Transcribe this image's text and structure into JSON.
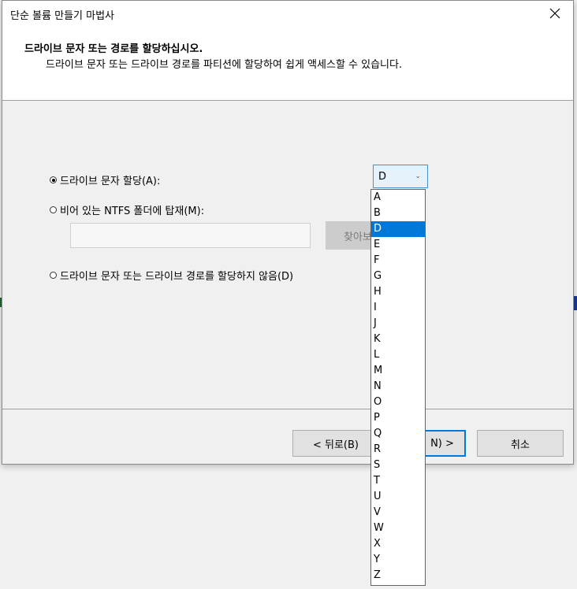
{
  "window": {
    "title": "단순 볼륨 만들기 마법사"
  },
  "header": {
    "title": "드라이브 문자 또는 경로를 할당하십시오.",
    "subtitle": "드라이브 문자 또는 드라이브 경로를 파티션에 할당하여 쉽게 액세스할 수 있습니다."
  },
  "options": {
    "assign_letter": "드라이브 문자 할당(A):",
    "mount_folder": "비어 있는 NTFS 폴더에 탑재(M):",
    "no_assign": "드라이브 문자 또는 드라이브 경로를 할당하지 않음(D)",
    "selected": "assign_letter"
  },
  "combo": {
    "value": "D"
  },
  "folder": {
    "path_value": "",
    "browse_label": "찾아보"
  },
  "dropdown": {
    "items": [
      "A",
      "B",
      "D",
      "E",
      "F",
      "G",
      "H",
      "I",
      "J",
      "K",
      "L",
      "M",
      "N",
      "O",
      "P",
      "Q",
      "R",
      "S",
      "T",
      "U",
      "V",
      "W",
      "X",
      "Y",
      "Z"
    ],
    "selected": "D"
  },
  "buttons": {
    "back": "< 뒤로(B)",
    "next": "N) >",
    "cancel": "취소"
  },
  "colors": {
    "accent": "#0078d7",
    "combo_border": "#4a8fd0"
  }
}
